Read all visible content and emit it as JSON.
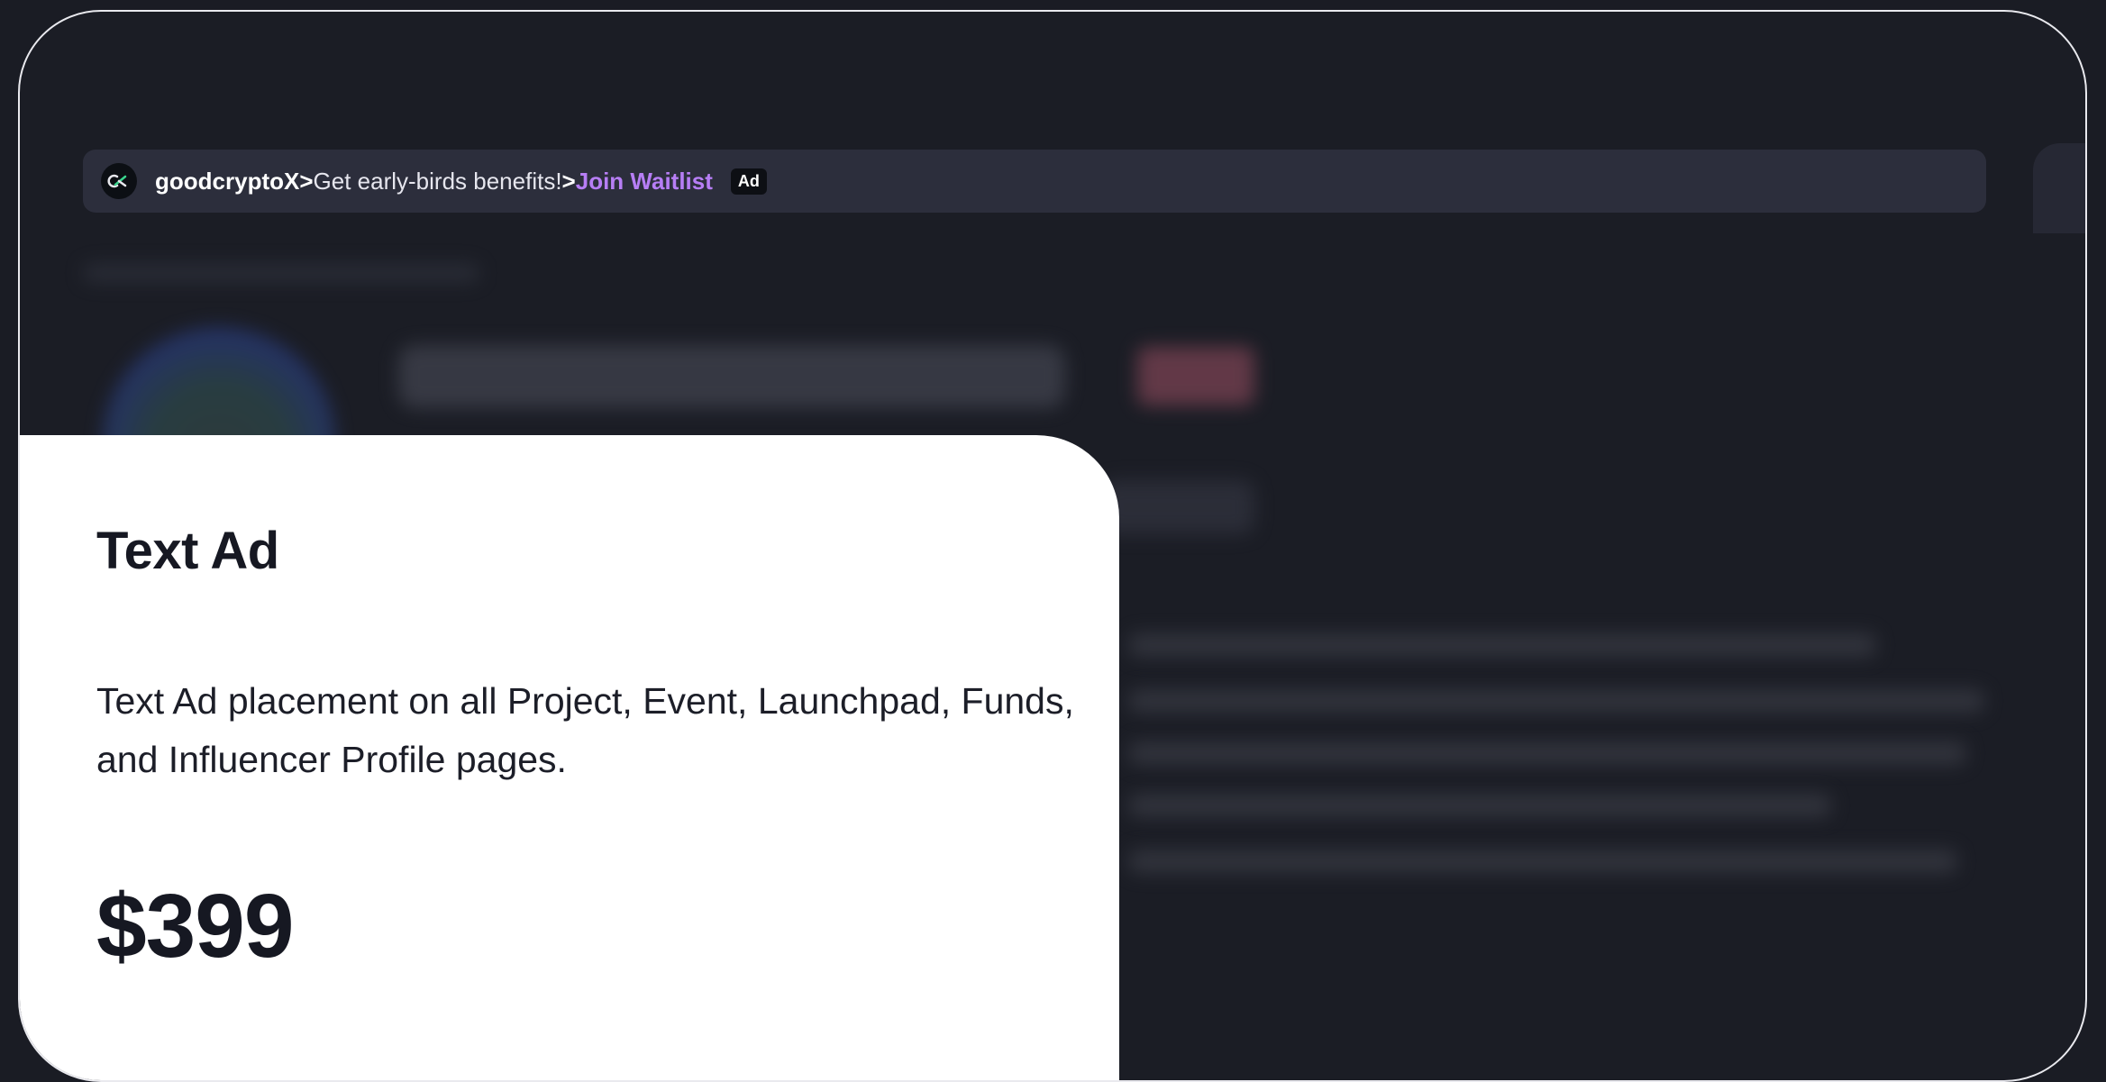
{
  "ad_bar": {
    "logo_icon": "goodcrypto-logo-icon",
    "brand": "goodcryptoX",
    "separator1": ">",
    "text": "Get early-birds benefits!",
    "separator2": ">",
    "cta": "Join Waitlist",
    "badge": "Ad"
  },
  "card": {
    "title": "Text Ad",
    "description": "Text Ad placement on all Project, Event, Launchpad, Funds, and Influencer Profile pages.",
    "price": "$399"
  },
  "colors": {
    "background": "#1b1d25",
    "ad_bar": "#2c2e3c",
    "cta": "#b77ef5",
    "card": "#ffffff",
    "logo_accent": "#3ad58e"
  }
}
